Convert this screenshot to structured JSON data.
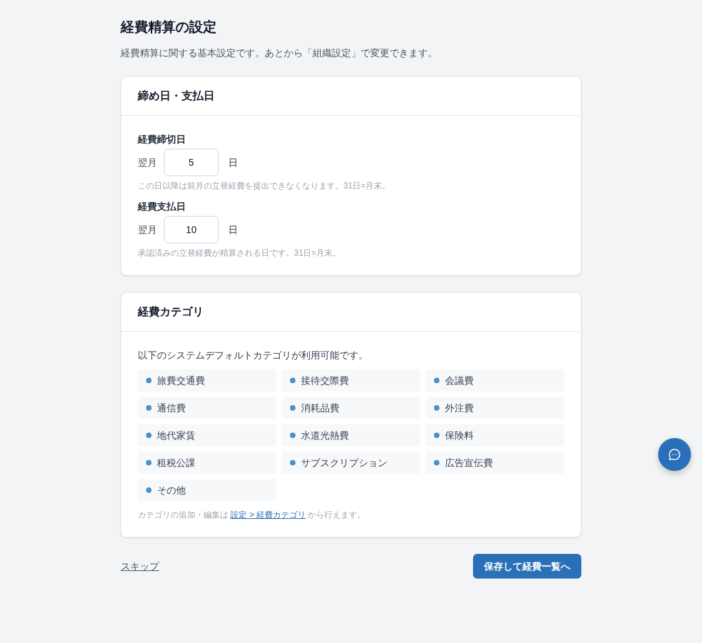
{
  "page": {
    "title": "経費精算の設定",
    "description": "経費精算に関する基本設定です。あとから「組織設定」で変更できます。"
  },
  "cards": [
    {
      "kind": "dates",
      "title": "締め日・支払日",
      "fields": [
        {
          "label": "経費締切日",
          "prefix": "翌月",
          "value": "5",
          "suffix": "日",
          "hint": "この日以降は前月の立替経費を提出できなくなります。31日=月末。"
        },
        {
          "label": "経費支払日",
          "prefix": "翌月",
          "value": "10",
          "suffix": "日",
          "hint": "承認済みの立替経費が精算される日です。31日=月末。"
        }
      ]
    },
    {
      "kind": "categories",
      "title": "経費カテゴリ",
      "intro": "以下のシステムデフォルトカテゴリが利用可能です。",
      "categories": [
        "旅費交通費",
        "接待交際費",
        "会議費",
        "通信費",
        "消耗品費",
        "外注費",
        "地代家賃",
        "水道光熱費",
        "保険料",
        "租税公課",
        "サブスクリプション",
        "広告宣伝費",
        "その他"
      ],
      "note": {
        "before": "カテゴリの追加・編集は",
        "link": "設定 > 経費カテゴリ",
        "after": "から行えます。"
      }
    }
  ],
  "actions": {
    "skip": "スキップ",
    "save": "保存して経費一覧へ"
  }
}
